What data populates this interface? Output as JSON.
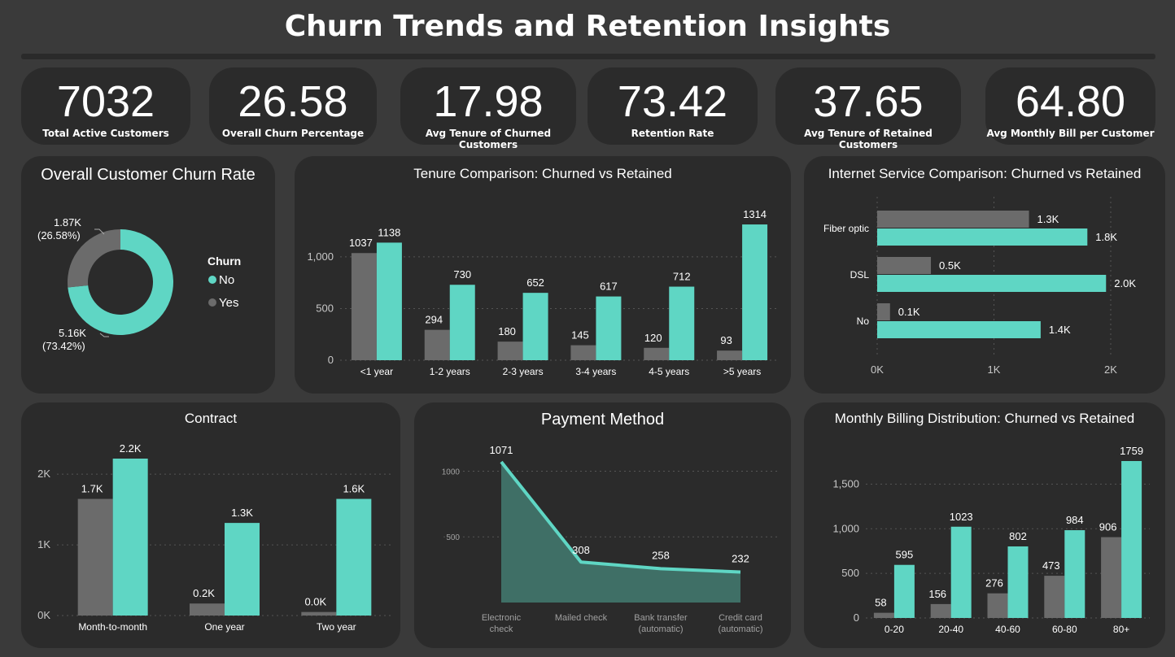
{
  "header": {
    "title": "Churn Trends and Retention Insights"
  },
  "kpis": [
    {
      "value": "7032",
      "label": "Total Active Customers"
    },
    {
      "value": "26.58",
      "label": "Overall Churn Percentage"
    },
    {
      "value": "17.98",
      "label": "Avg Tenure of Churned Customers"
    },
    {
      "value": "73.42",
      "label": "Retention Rate"
    },
    {
      "value": "37.65",
      "label": "Avg Tenure of Retained Customers"
    },
    {
      "value": "64.80",
      "label": "Avg Monthly Bill per Customer"
    }
  ],
  "colors": {
    "churned": "#6b6b6b",
    "retained": "#5fd6c4",
    "card": "#2b2b2b",
    "background": "#3a3a3a",
    "text": "#ffffff",
    "tick": "#c8c8c8"
  },
  "chart_data": [
    {
      "id": "donut",
      "type": "pie",
      "title": "Overall Customer Churn Rate",
      "legend_title": "Churn",
      "legend_position": "right",
      "slices": [
        {
          "name": "No",
          "value": 5.16,
          "label": "5.16K",
          "pct_label": "(73.42%)",
          "share": 73.42
        },
        {
          "name": "Yes",
          "value": 1.87,
          "label": "1.87K",
          "pct_label": "(26.58%)",
          "share": 26.58
        }
      ]
    },
    {
      "id": "tenure",
      "type": "bar",
      "title": "Tenure Comparison: Churned vs Retained",
      "categories": [
        "<1 year",
        "1-2 years",
        "2-3 years",
        "3-4 years",
        "4-5 years",
        ">5 years"
      ],
      "series": [
        {
          "key": "churned",
          "values": [
            1037,
            294,
            180,
            145,
            120,
            93
          ],
          "labels": [
            "1037",
            "294",
            "180",
            "145",
            "120",
            "93"
          ]
        },
        {
          "key": "retained",
          "values": [
            1138,
            730,
            652,
            617,
            712,
            1314
          ],
          "labels": [
            "1138",
            "730",
            "652",
            "617",
            "712",
            "1314"
          ]
        }
      ],
      "yticks": [
        0,
        500,
        1000
      ],
      "ytick_labels": [
        "0",
        "500",
        "1,000"
      ],
      "ylim": [
        0,
        1330
      ]
    },
    {
      "id": "internet",
      "type": "bar",
      "orientation": "horizontal",
      "title": "Internet Service Comparison: Churned vs Retained",
      "categories": [
        "Fiber optic",
        "DSL",
        "No"
      ],
      "series": [
        {
          "key": "churned",
          "values": [
            1.3,
            0.46,
            0.11
          ],
          "labels": [
            "1.3K",
            "0.5K",
            "0.1K"
          ]
        },
        {
          "key": "retained",
          "values": [
            1.8,
            1.96,
            1.4
          ],
          "labels": [
            "1.8K",
            "2.0K",
            "1.4K"
          ]
        }
      ],
      "xticks": [
        0,
        1,
        2
      ],
      "xtick_labels": [
        "0K",
        "1K",
        "2K"
      ],
      "xlim": [
        0,
        2.0
      ]
    },
    {
      "id": "contract",
      "type": "bar",
      "title": "Contract",
      "categories": [
        "Month-to-month",
        "One year",
        "Two year"
      ],
      "series": [
        {
          "key": "churned",
          "values": [
            1.65,
            0.17,
            0.05
          ],
          "labels": [
            "1.7K",
            "0.2K",
            "0.0K"
          ]
        },
        {
          "key": "retained",
          "values": [
            2.22,
            1.31,
            1.65
          ],
          "labels": [
            "2.2K",
            "1.3K",
            "1.6K"
          ]
        }
      ],
      "yticks": [
        0,
        1,
        2
      ],
      "ytick_labels": [
        "0K",
        "1K",
        "2K"
      ],
      "ylim": [
        0,
        2.22
      ]
    },
    {
      "id": "payment",
      "type": "area",
      "title": "Payment Method",
      "categories": [
        "Electronic\ncheck",
        "Mailed check",
        "Bank transfer\n(automatic)",
        "Credit card\n(automatic)"
      ],
      "values": [
        1071,
        308,
        258,
        232
      ],
      "labels": [
        "1071",
        "308",
        "258",
        "232"
      ],
      "yticks": [
        500,
        1000
      ],
      "ytick_labels": [
        "500",
        "1000"
      ],
      "ylim": [
        0,
        1071
      ]
    },
    {
      "id": "billing",
      "type": "bar",
      "title": "Monthly Billing Distribution: Churned vs Retained",
      "categories": [
        "0-20",
        "20-40",
        "40-60",
        "60-80",
        "80+"
      ],
      "series": [
        {
          "key": "churned",
          "values": [
            58,
            156,
            276,
            473,
            906
          ],
          "labels": [
            "58",
            "156",
            "276",
            "473",
            "906"
          ]
        },
        {
          "key": "retained",
          "values": [
            595,
            1023,
            802,
            984,
            1759
          ],
          "labels": [
            "595",
            "1023",
            "802",
            "984",
            "1759"
          ]
        }
      ],
      "yticks": [
        0,
        500,
        1000,
        1500
      ],
      "ytick_labels": [
        "0",
        "500",
        "1,000",
        "1,500"
      ],
      "ylim": [
        0,
        1759
      ]
    }
  ]
}
